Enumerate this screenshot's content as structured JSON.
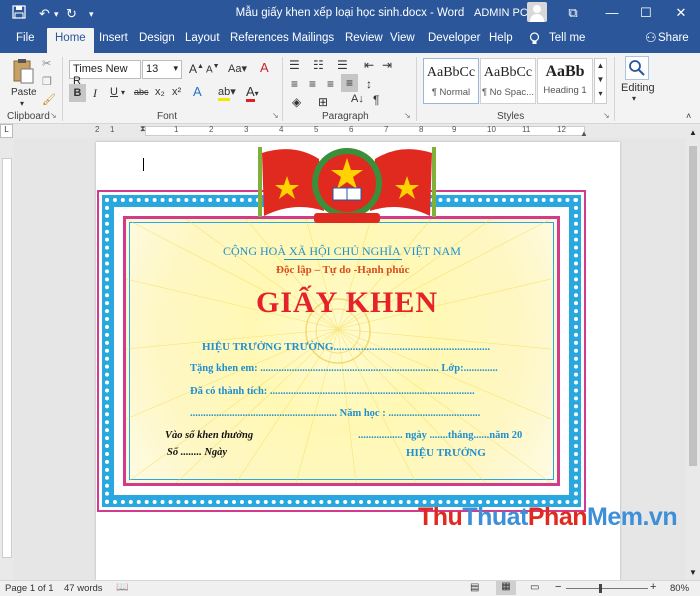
{
  "titlebar": {
    "title": "Mẫu giấy khen xếp loại học sinh.docx  -  Word",
    "user": "ADMIN PC",
    "restore_glyph": "⧉",
    "minimize_glyph": "—",
    "maximize_glyph": "☐",
    "close_glyph": "✕"
  },
  "tabs": [
    "File",
    "Home",
    "Insert",
    "Design",
    "Layout",
    "References",
    "Mailings",
    "Review",
    "View",
    "Developer",
    "Help"
  ],
  "tell_me": "Tell me",
  "share": "Share",
  "ribbon": {
    "clipboard_label": "Clipboard",
    "paste_label": "Paste",
    "font_label": "Font",
    "font_name": "Times New R",
    "font_size": "13",
    "paragraph_label": "Paragraph",
    "styles_label": "Styles",
    "styles": [
      {
        "preview": "AaBbCc",
        "name": "¶ Normal"
      },
      {
        "preview": "AaBbCc",
        "name": "¶ No Spac..."
      },
      {
        "preview": "AaBb",
        "name": "Heading 1"
      }
    ],
    "editing_label": "Editing",
    "bold": "B",
    "italic": "I",
    "underline": "U",
    "strike": "abc",
    "sub": "x₂",
    "sup": "x²",
    "grow": "A",
    "shrink": "A",
    "case": "Aa",
    "clear": "A"
  },
  "ruler_numbers": [
    "1",
    "2",
    "1",
    "2",
    "3",
    "4",
    "5",
    "6",
    "7",
    "8",
    "9",
    "10",
    "11",
    "12"
  ],
  "certificate": {
    "header1": "CỘNG HOÀ XÃ HỘI CHỦ NGHĨA VIỆT NAM",
    "header2": "Độc lập – Tự do -Hạnh phúc",
    "title": "GIẤY KHEN",
    "line1": "HIỆU TRƯỞNG TRƯỜNG.........................................................",
    "line2": "Tặng khen em: ....................................................................  Lớp:.............",
    "line3": "Đã có thành tích: ..............................................................................",
    "line4": "........................................................ Năm học : ...................................",
    "line5_left": "Vào sổ khen thưởng",
    "line5_right": "................. ngày .......tháng......năm 20",
    "line6_left": "Số ........ Ngày",
    "line6_right": "HIỆU TRƯỞNG",
    "colors": {
      "title": "#e52229",
      "blue": "#1e8fd0",
      "header2": "#d84c1f"
    }
  },
  "watermark": {
    "part1": "Thu",
    "part2": "Thuat",
    "part3": "Phan",
    "part4": "Mem",
    "part5": ".vn"
  },
  "status": {
    "page": "Page 1 of 1",
    "words": "47 words",
    "zoom": "80%"
  }
}
